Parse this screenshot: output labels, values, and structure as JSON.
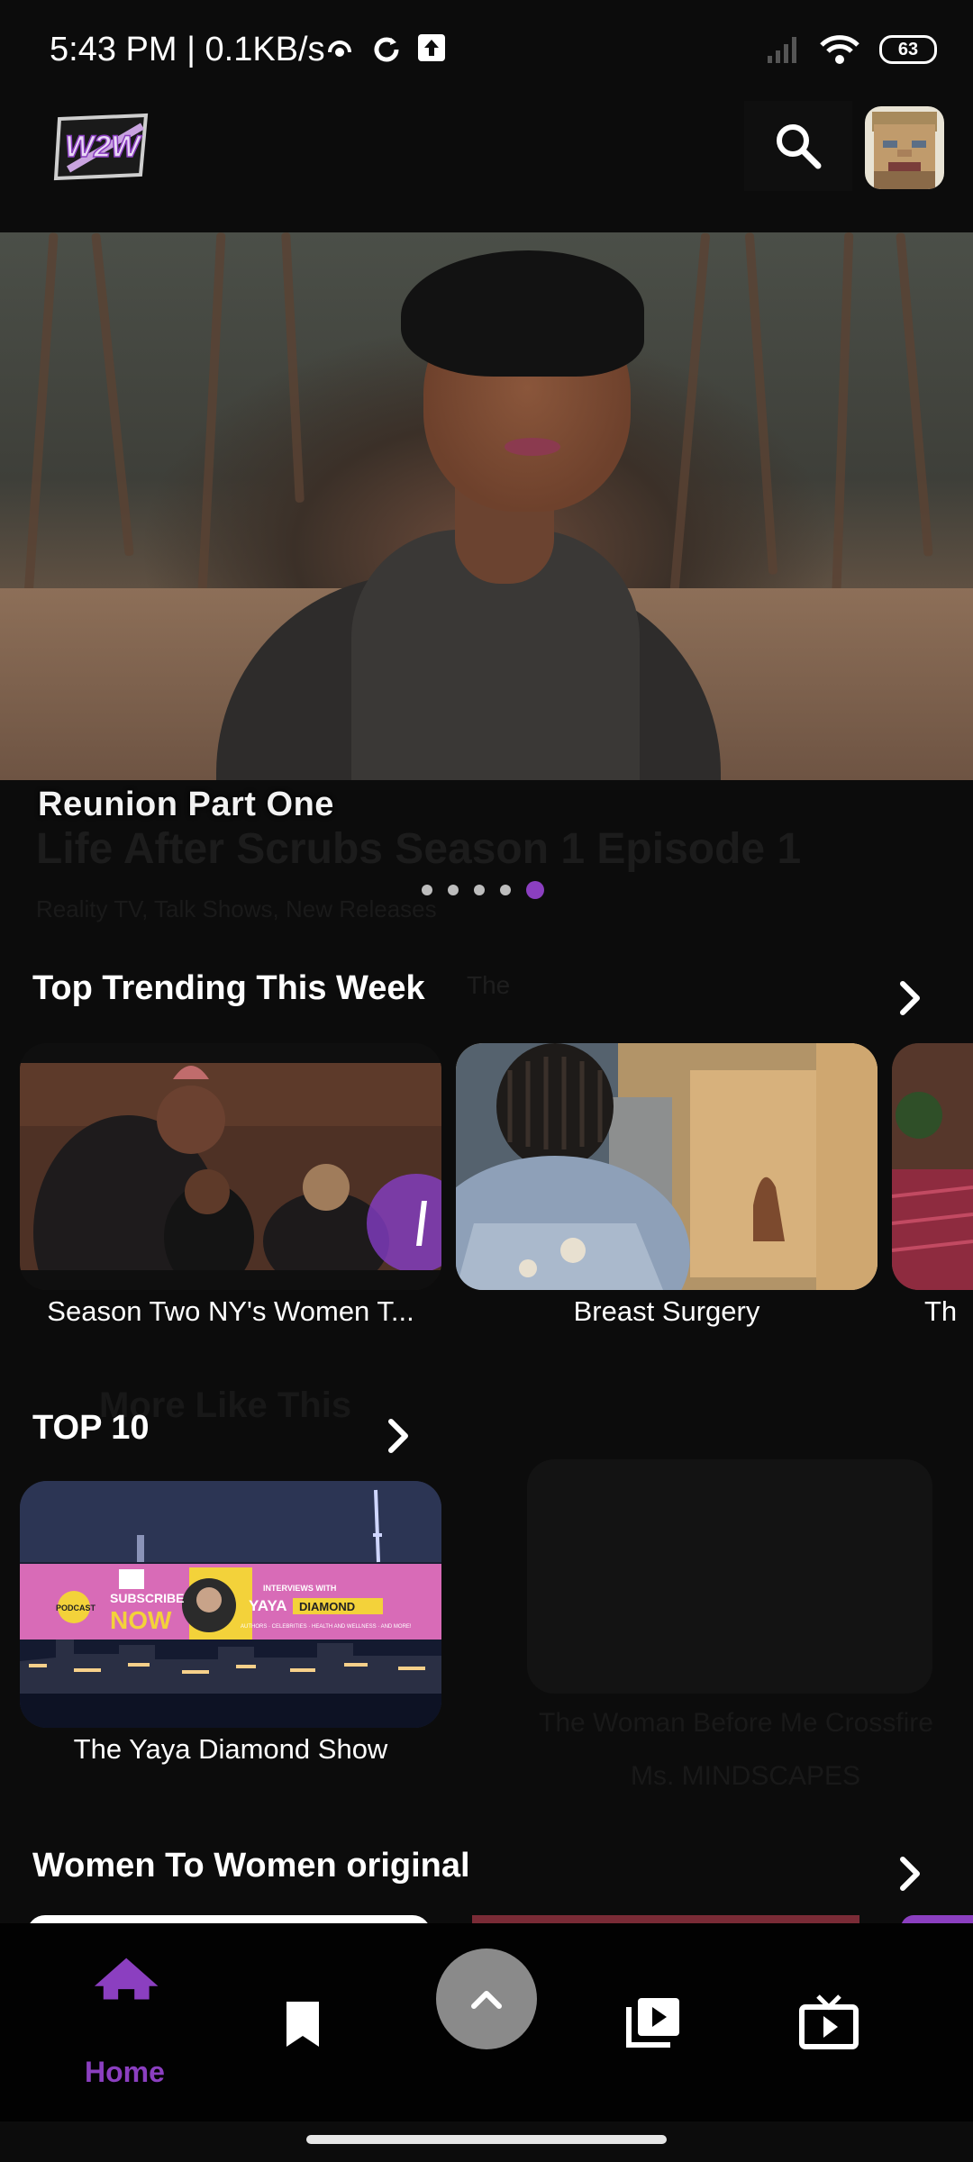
{
  "status_bar": {
    "time_and_speed": "5:43 PM | 0.1KB/s",
    "battery": "63"
  },
  "app_bar": {
    "logo_text": "W2W"
  },
  "hero": {
    "title": "Reunion Part One",
    "background_subtitle": "Life After Scrubs Season 1 Episode 1",
    "background_genres": "Reality TV, Talk Shows, New Releases",
    "carousel": {
      "count": 5,
      "active_index": 4
    }
  },
  "sections": {
    "trending": {
      "title": "Top Trending This Week",
      "ghost": "The",
      "items": [
        {
          "label": "Season Two NY's Women T..."
        },
        {
          "label": "Breast Surgery"
        },
        {
          "label": "Th"
        }
      ]
    },
    "top10": {
      "title": "TOP 10",
      "ghost_title": "More Like This",
      "items": [
        {
          "label": "The Yaya Diamond Show",
          "banner": {
            "podcast": "PODCAST",
            "subscribe": "SUBSCRIBE",
            "now": "NOW",
            "interviews_with": "INTERVIEWS WITH",
            "yaya": "YAYA",
            "diamond": "DIAMOND",
            "tagline": "AUTHORS · CELEBRITIES · HEALTH AND WELLNESS · AND MORE!"
          }
        }
      ],
      "ghost_card_line1": "The Woman Before Me Crossfire",
      "ghost_card_line2": "Ms. MINDSCAPES"
    },
    "originals": {
      "title": "Women To Women original"
    }
  },
  "bottom_nav": {
    "home_label": "Home"
  },
  "colors": {
    "accent": "#8b3fc0",
    "background": "#0c0c0c"
  },
  "icons": [
    "search-icon",
    "chevron-right-icon",
    "home-icon",
    "bookmark-icon",
    "chevron-up-icon",
    "playlist-play-icon",
    "tv-play-icon"
  ]
}
